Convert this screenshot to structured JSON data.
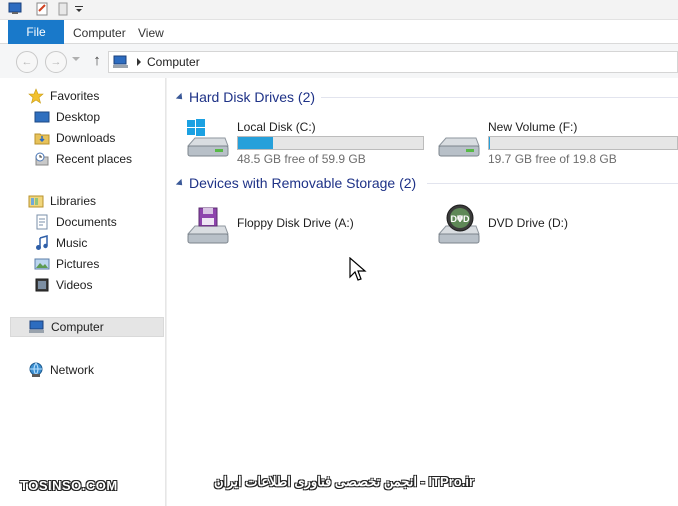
{
  "ribbon": {
    "tabs": [
      "File",
      "Computer",
      "View"
    ]
  },
  "address": {
    "crumb": "Computer"
  },
  "nav": {
    "favorites": "Favorites",
    "desktop": "Desktop",
    "downloads": "Downloads",
    "recent": "Recent places",
    "libraries": "Libraries",
    "documents": "Documents",
    "music": "Music",
    "pictures": "Pictures",
    "videos": "Videos",
    "computer": "Computer",
    "network": "Network"
  },
  "groups": {
    "hdd": "Hard Disk Drives (2)",
    "removable": "Devices with Removable Storage (2)"
  },
  "drives": {
    "c": {
      "name": "Local Disk (C:)",
      "free": "48.5 GB free of 59.9 GB",
      "used_fraction": 0.19
    },
    "f": {
      "name": "New Volume (F:)",
      "free": "19.7 GB free of 19.8 GB",
      "used_fraction": 0.005
    },
    "a": {
      "name": "Floppy Disk Drive (A:)"
    },
    "d": {
      "name": "DVD Drive (D:)",
      "badge": "DVD"
    }
  },
  "watermark": {
    "left": "TOSINSO.COM",
    "right": "انجمن تخصصی فناوری اطلاعات ایران - ITPro.ir"
  },
  "colors": {
    "accent": "#1979ca",
    "bar_fill": "#26a0da",
    "group_title": "#1e3287"
  }
}
